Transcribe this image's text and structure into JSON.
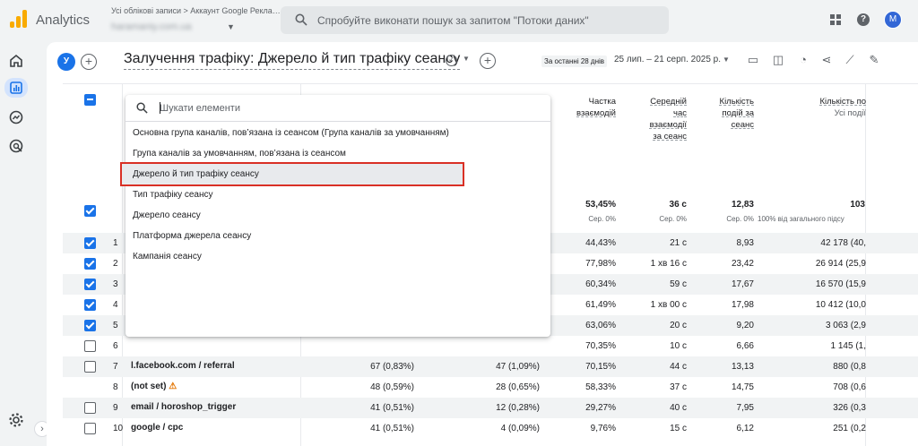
{
  "app": {
    "name": "Analytics",
    "breadcrumb": "Усі облікові записи > Аккаунт Google Рекла…",
    "account_name": "haramaniy.com.ua",
    "search_placeholder": "Спробуйте виконати пошук за запитом \"Потоки даних\"",
    "avatar_letter": "M"
  },
  "report": {
    "segment_badge": "У",
    "title": "Залучення трафіку: Джерело й тип трафіку сеансу",
    "date_label": "За останні 28 днів",
    "date_range": "25 лип. – 21 серп. 2025 р."
  },
  "columns": [
    {
      "label": "Частка взаємодій",
      "lines": [
        "Частка",
        "взаємодій"
      ]
    },
    {
      "label": "Середній час взаємодії за сеанс",
      "lines": [
        "Середній",
        "час",
        "взаємодії",
        "за сеанс"
      ]
    },
    {
      "label": "Кількість подій за сеанс",
      "lines": [
        "Кількість",
        "подій за",
        "сеанс"
      ]
    },
    {
      "label": "Кількість по…",
      "lines": [
        "Кількість по",
        "Усі події"
      ]
    }
  ],
  "totals": {
    "engagement_rate": "53,45%",
    "engagement_rate_sub": "Сер. 0%",
    "avg_time": "36 с",
    "avg_time_sub": "Сер. 0%",
    "events_per_session": "12,83",
    "events_per_session_sub": "Сер. 0%",
    "events": "103",
    "events_sub": "100% від загального підсу"
  },
  "rows": [
    {
      "n": "1",
      "dim": "",
      "c1": "",
      "c2": "",
      "er": "44,43%",
      "at": "21 с",
      "eps": "8,93",
      "ev": "42 178 (40,"
    },
    {
      "n": "2",
      "dim": "",
      "c1": "",
      "c2": "",
      "er": "77,98%",
      "at": "1 хв 16 с",
      "eps": "23,42",
      "ev": "26 914 (25,9"
    },
    {
      "n": "3",
      "dim": "",
      "c1": "",
      "c2": "",
      "er": "60,34%",
      "at": "59 с",
      "eps": "17,67",
      "ev": "16 570 (15,9"
    },
    {
      "n": "4",
      "dim": "",
      "c1": "",
      "c2": "",
      "er": "61,49%",
      "at": "1 хв 00 с",
      "eps": "17,98",
      "ev": "10 412 (10,0"
    },
    {
      "n": "5",
      "dim": "",
      "c1": "",
      "c2": "",
      "er": "63,06%",
      "at": "20 с",
      "eps": "9,20",
      "ev": "3 063 (2,9"
    },
    {
      "n": "6",
      "dim": "",
      "c1": "",
      "c2": "",
      "er": "70,35%",
      "at": "10 с",
      "eps": "6,66",
      "ev": "1 145 (1,"
    },
    {
      "n": "7",
      "dim": "l.facebook.com / referral",
      "c1": "67 (0,83%)",
      "c2": "47 (1,09%)",
      "er": "70,15%",
      "at": "44 с",
      "eps": "13,13",
      "ev": "880 (0,8"
    },
    {
      "n": "8",
      "dim": "(not set)",
      "c1": "48 (0,59%)",
      "c2": "28 (0,65%)",
      "er": "58,33%",
      "at": "37 с",
      "eps": "14,75",
      "ev": "708 (0,6"
    },
    {
      "n": "9",
      "dim": "email / horoshop_trigger",
      "c1": "41 (0,51%)",
      "c2": "12 (0,28%)",
      "er": "29,27%",
      "at": "40 с",
      "eps": "7,95",
      "ev": "326 (0,3"
    },
    {
      "n": "10",
      "dim": "google / cpc",
      "c1": "41 (0,51%)",
      "c2": "4 (0,09%)",
      "er": "9,76%",
      "at": "15 с",
      "eps": "6,12",
      "ev": "251 (0,2"
    }
  ],
  "dropdown": {
    "placeholder": "Шукати елементи",
    "items": [
      "Основна група каналів, пов’язана із сеансом (Група каналів за умовчанням)",
      "Група каналів за умовчанням, пов’язана із сеансом",
      "Джерело й тип трафіку сеансу",
      "Тип трафіку сеансу",
      "Джерело сеансу",
      "Платформа джерела сеансу",
      "Кампанія сеансу"
    ],
    "selected_index": 2
  },
  "colors": {
    "accent": "#1a73e8",
    "highlight": "#d93025",
    "logo": "#f9ab00"
  }
}
